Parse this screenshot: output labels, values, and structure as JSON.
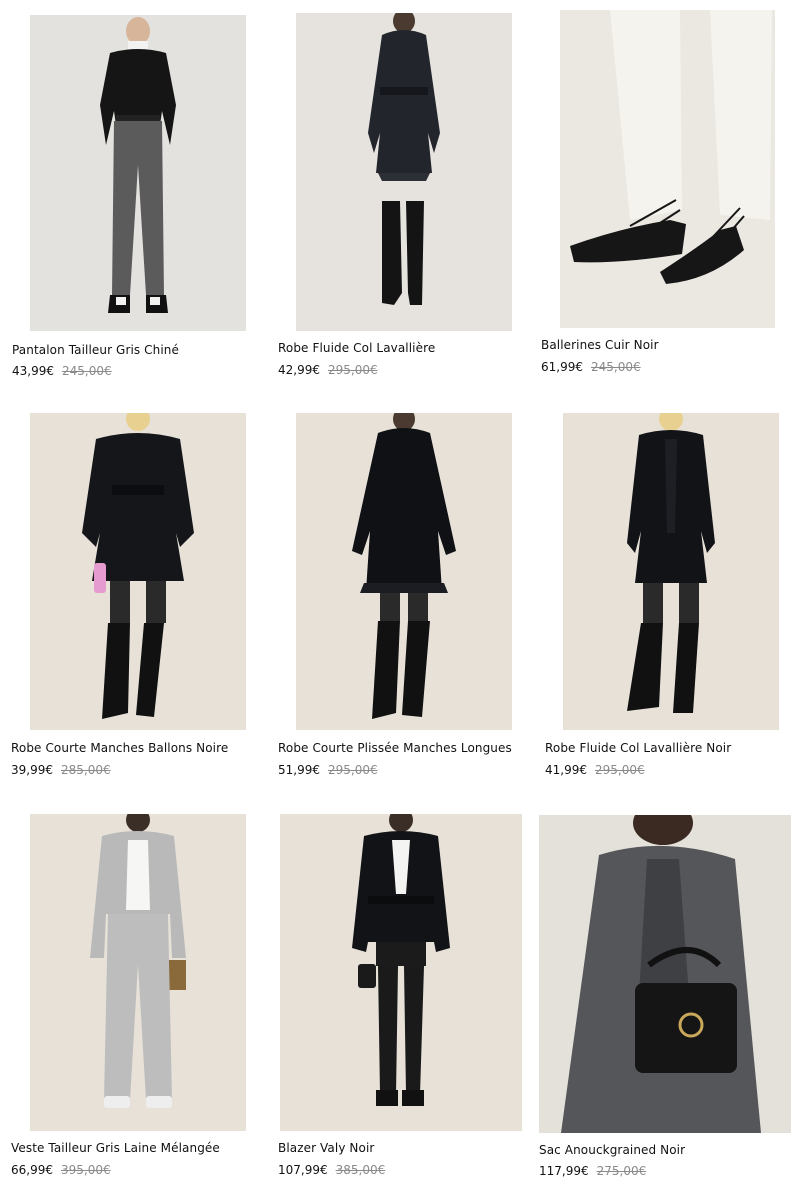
{
  "products": [
    {
      "name": "Pantalon Tailleur Gris Chiné",
      "price": "43,99€",
      "original_price": "245,00€",
      "image": "model-grey-trousers-black-sweater",
      "bg": "#e4e2df"
    },
    {
      "name": "Robe Fluide Col Lavallière",
      "price": "42,99€",
      "original_price": "295,00€",
      "image": "model-sheer-navy-dress-boots",
      "bg": "#e6e3df"
    },
    {
      "name": "Ballerines Cuir Noir",
      "price": "61,99€",
      "original_price": "245,00€",
      "image": "black-lace-up-ballet-flats",
      "bg": "#ebe7e1"
    },
    {
      "name": "Robe Courte Manches Ballons Noire",
      "price": "39,99€",
      "original_price": "285,00€",
      "image": "model-black-wrap-dress-pink-bag",
      "bg": "#e7e1d8"
    },
    {
      "name": "Robe Courte Plissée Manches Longues",
      "price": "51,99€",
      "original_price": "295,00€",
      "image": "model-black-pleated-dress-boots",
      "bg": "#e7e1d8"
    },
    {
      "name": "Robe Fluide Col Lavallière Noir",
      "price": "41,99€",
      "original_price": "295,00€",
      "image": "model-black-bow-dress-boots",
      "bg": "#e7e1d8"
    },
    {
      "name": "Veste Tailleur Gris Laine Mélangée",
      "price": "66,99€",
      "original_price": "395,00€",
      "image": "model-grey-suit-leopard-clutch",
      "bg": "#e7e1d8"
    },
    {
      "name": "Blazer Valy Noir",
      "price": "107,99€",
      "original_price": "385,00€",
      "image": "model-black-belted-blazer",
      "bg": "#e7e1d8"
    },
    {
      "name": "Sac Anouckgrained Noir",
      "price": "117,99€",
      "original_price": "275,00€",
      "image": "black-handbag-grey-coat",
      "bg": "#e4e0da"
    }
  ]
}
